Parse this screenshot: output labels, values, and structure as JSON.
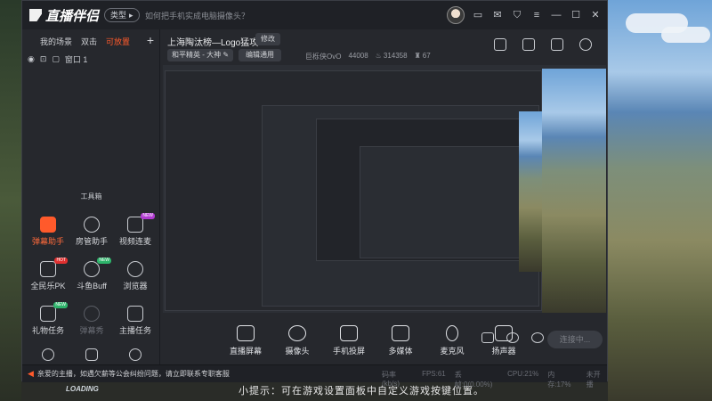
{
  "app": {
    "name": "直播伴侣",
    "type_label": "类型",
    "tip_link": "如何把手机实成电脑摄像头？"
  },
  "title_icons": [
    "avatar",
    "feedback-icon",
    "message-icon",
    "shirt-icon",
    "menu-icon",
    "minimize-icon",
    "maximize-icon",
    "close-icon"
  ],
  "scene_panel": {
    "tabs": [
      "我的场景",
      "双击",
      "可放置"
    ],
    "active_tab": 2,
    "add_label": "+",
    "scene_item": "窗口 1"
  },
  "toolbox": {
    "title": "工具箱",
    "tools": [
      {
        "label": "弹幕助手",
        "state": "active",
        "icon": "danmaku-icon"
      },
      {
        "label": "房管助手",
        "state": "normal",
        "icon": "admin-icon"
      },
      {
        "label": "视频连麦",
        "state": "normal",
        "icon": "video-link-icon",
        "badge": "NEW"
      },
      {
        "label": "全民乐PK",
        "state": "normal",
        "icon": "pk-icon",
        "badge": "HOT"
      },
      {
        "label": "斗鱼Buff",
        "state": "normal",
        "icon": "buff-icon",
        "badge": "NEW"
      },
      {
        "label": "浏览器",
        "state": "normal",
        "icon": "browser-icon"
      },
      {
        "label": "礼物任务",
        "state": "normal",
        "icon": "gift-task-icon",
        "badge": "NEW"
      },
      {
        "label": "弹幕秀",
        "state": "disabled",
        "icon": "danmaku-show-icon"
      },
      {
        "label": "主播任务",
        "state": "normal",
        "icon": "anchor-task-icon"
      },
      {
        "label": "",
        "state": "normal",
        "icon": "search-icon"
      },
      {
        "label": "",
        "state": "normal",
        "icon": "house-icon"
      },
      {
        "label": "",
        "state": "normal",
        "icon": "more-icon"
      }
    ]
  },
  "room": {
    "title": "上海陶汰榜—Logo猛攻",
    "edit_label": "修改",
    "category": "和平精英 - 大神",
    "edit_common_label": "编辑通用",
    "user": "巨栎侠OvO",
    "id": "44008",
    "hot": "314358",
    "fans": "67"
  },
  "controls": [
    {
      "label": "直播屏幕",
      "icon": "screen-icon"
    },
    {
      "label": "摄像头",
      "icon": "camera-icon"
    },
    {
      "label": "手机投屏",
      "icon": "phone-cast-icon"
    },
    {
      "label": "多媒体",
      "icon": "media-icon"
    },
    {
      "label": "麦克风",
      "icon": "mic-icon"
    },
    {
      "label": "扬声器",
      "icon": "speaker-icon"
    }
  ],
  "connect_label": "连接中...",
  "statusbar": {
    "notice": "亲爱的主播，如遇欠薪等公会纠纷问题，请立即联系专职客服",
    "bitrate": "码率(kb/s)",
    "fps": "FPS:61",
    "drop": "丢帧:0(0.00%)",
    "cpu": "CPU:21%",
    "mem": "内存:17%",
    "live": "未开播"
  },
  "game_hint": "小提示：可在游戏设置面板中自定义游戏按键位置。",
  "loading": "LOADING",
  "colors": {
    "accent": "#ff5a2b",
    "bg": "#26282d",
    "titlebar": "#1f2126"
  }
}
